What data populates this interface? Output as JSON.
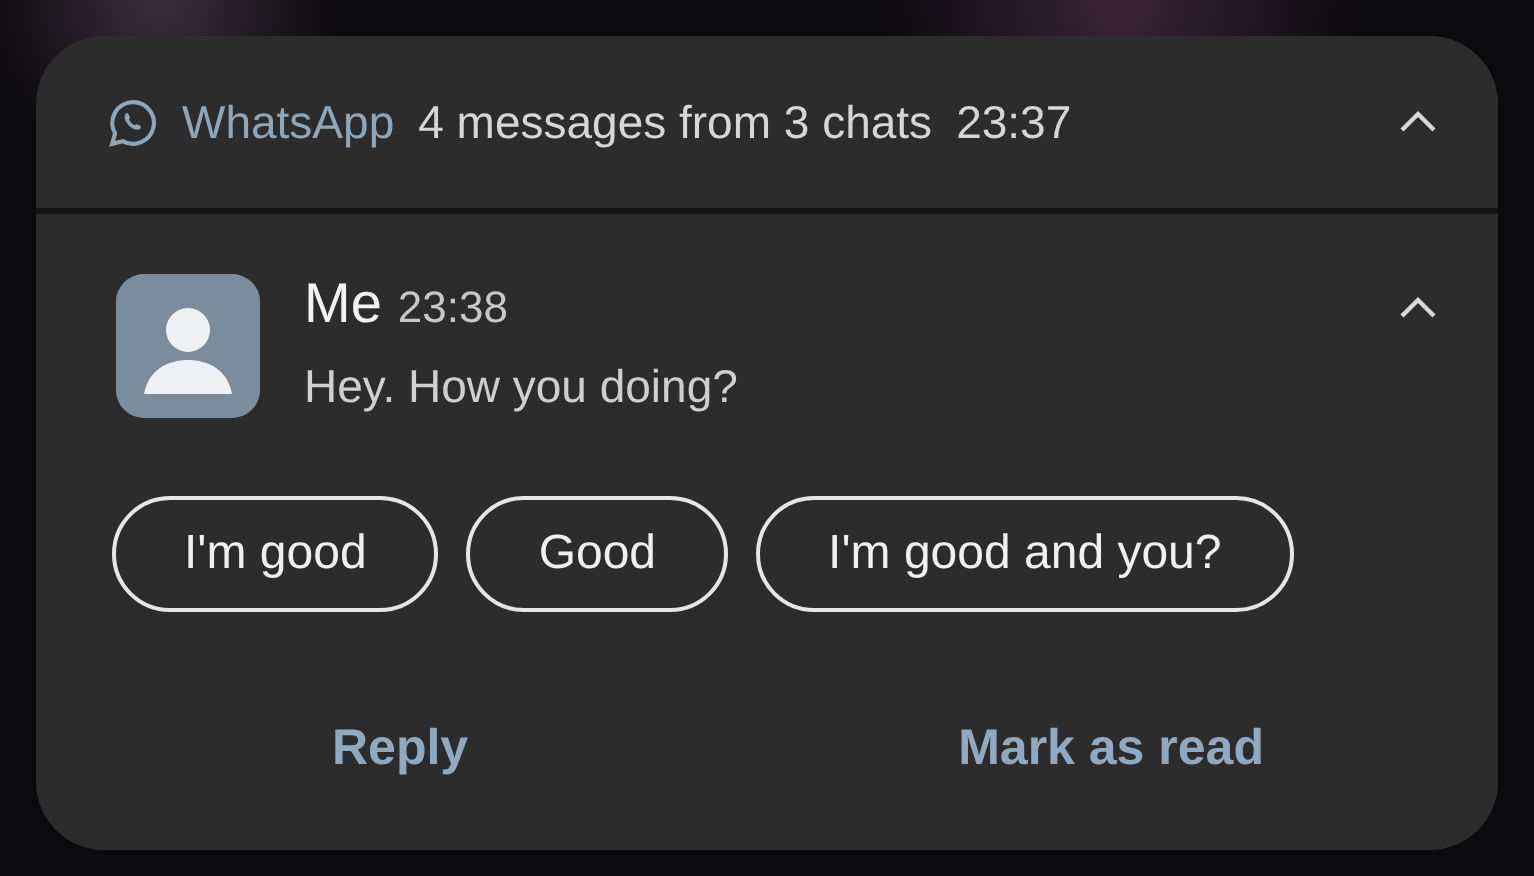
{
  "header": {
    "app_name": "WhatsApp",
    "summary": "4 messages from 3 chats",
    "time": "23:37",
    "expanded": true
  },
  "message": {
    "sender": "Me",
    "time": "23:38",
    "text": "Hey. How you doing?",
    "expanded": true
  },
  "smart_replies": [
    "I'm good",
    "Good",
    "I'm good and you?"
  ],
  "actions": [
    "Reply",
    "Mark as read"
  ]
}
